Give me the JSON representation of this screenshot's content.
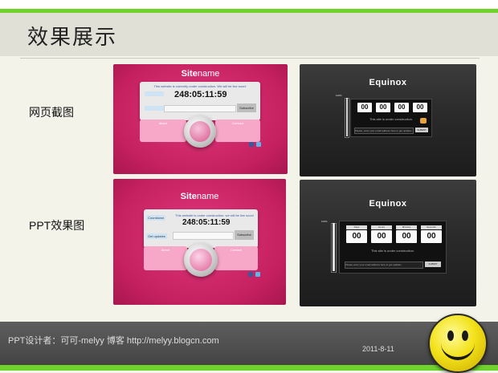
{
  "slide": {
    "title": "效果展示",
    "row_labels": [
      "网页截图",
      "PPT效果图"
    ]
  },
  "screenshot_panels": {
    "pink_top": {
      "site_bold": "Site",
      "site_rest": "name",
      "notice": "This website is currently under construction. We will be live soon!",
      "timer": "248:05:11:59",
      "subscribe": "Subscribe",
      "card_left_label": "About",
      "card_right_label": "Contact"
    },
    "dark_top": {
      "brand": "Equinox",
      "percent": "100%",
      "digits": [
        "00",
        "00",
        "00",
        "00"
      ],
      "construction_text": "This site is under construction.",
      "email_placeholder": "Please, enter your email address here to get updates",
      "submit": "SUBMIT"
    },
    "pink_bottom": {
      "site_bold": "Site",
      "site_rest": "name",
      "countdown_label": "Countdown",
      "notice": "This website is under construction. we will be live soon!",
      "timer": "248:05:11:59",
      "get_updates": "Get updates",
      "subscribe": "Subscribe",
      "card_left_label": "About",
      "card_right_label": "Contact"
    },
    "dark_bottom": {
      "brand": "Equinox",
      "percent": "100%",
      "digits": [
        "00",
        "00",
        "00",
        "00"
      ],
      "digit_labels": [
        "Days",
        "Hours",
        "Minutes",
        "Seconds"
      ],
      "construction_text": "This site is under construction.",
      "email_placeholder": "Please enter your email address here to get updates",
      "submit": "SUBMIT"
    }
  },
  "footer": {
    "credit": "PPT设计者：可可-melyy  博客 http://melyy.blogcn.com",
    "date": "2011-8-11"
  },
  "colors": {
    "accent_green": "#6ed32a",
    "pink": "#c5205f",
    "dark": "#2a2a2a",
    "smiley_yellow": "#f3e21a"
  }
}
